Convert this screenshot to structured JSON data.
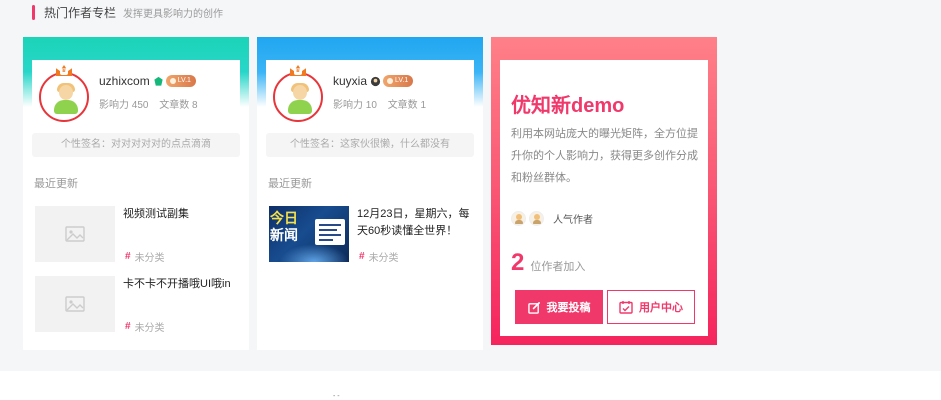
{
  "section": {
    "title": "热门作者专栏",
    "subtitle": "发挥更具影响力的创作",
    "accent": "#f0386b"
  },
  "authors": [
    {
      "name": "uzhixcom",
      "level_badge": "LV.1",
      "influence_label": "影响力 450",
      "articles_label": "文章数 8",
      "signature": "个性签名：对对对对对的点点滴滴",
      "recent_label": "最近更新",
      "posts": [
        {
          "title": "视频测试副集",
          "category": "未分类"
        },
        {
          "title": "卡不卡不开播哦UI哦in",
          "category": "未分类"
        }
      ]
    },
    {
      "name": "kuyxia",
      "level_badge": "LV.1",
      "influence_label": "影响力 10",
      "articles_label": "文章数 1",
      "signature": "个性签名：这家伙很懒，什么都没有",
      "recent_label": "最近更新",
      "posts": [
        {
          "title": "12月23日，星期六，每天60秒读懂全世界！",
          "category": "未分类",
          "thumb_line1": "今日",
          "thumb_line2": "新闻"
        }
      ]
    }
  ],
  "promo": {
    "title": "优知新demo",
    "description": "利用本网站庞大的曝光矩阵，全方位提升你的个人影响力，获得更多创作分成和粉丝群体。",
    "popular_label": "人气作者",
    "count": "2",
    "count_label": "位作者加入",
    "submit_label": "我要投稿",
    "user_center_label": "用户中心"
  },
  "footer": {
    "stub_text": "- -"
  }
}
